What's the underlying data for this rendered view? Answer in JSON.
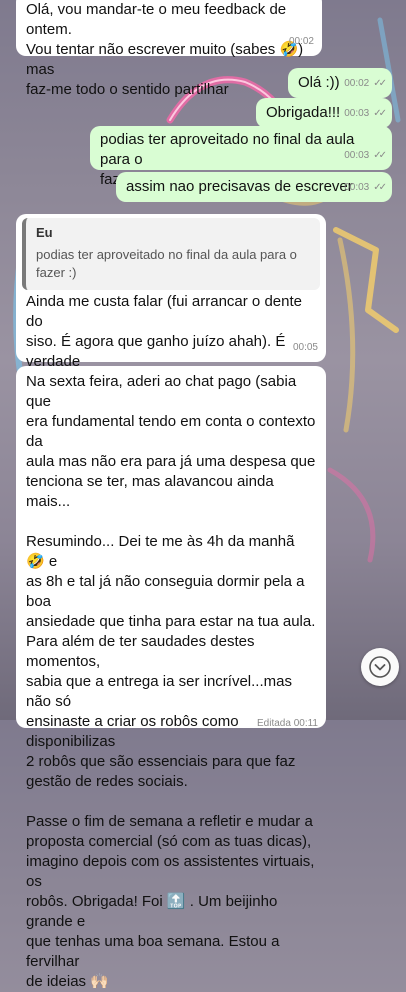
{
  "messages": [
    {
      "id": "m1",
      "direction": "incoming",
      "text": "Olá, vou mandar-te o meu feedback de ontem.\nVou tentar não escrever muito (sabes 🤣) mas\nfaz-me todo o sentido partilhar",
      "time": "00:02"
    },
    {
      "id": "m2",
      "direction": "outgoing",
      "text": "Olá :))",
      "time": "00:02",
      "status": "read"
    },
    {
      "id": "m3",
      "direction": "outgoing",
      "text": "Obrigada!!!",
      "time": "00:03",
      "status": "read"
    },
    {
      "id": "m4",
      "direction": "outgoing",
      "text": "podias ter aproveitado no final da aula para o\nfazer :)",
      "time": "00:03",
      "status": "read"
    },
    {
      "id": "m5",
      "direction": "outgoing",
      "text": "assim nao precisavas de escrever",
      "time": "00:03",
      "status": "read"
    },
    {
      "id": "m6",
      "direction": "incoming",
      "reply": {
        "author": "Eu",
        "text": "podias ter aproveitado no final da aula para o fazer :)"
      },
      "text": "Ainda me custa falar (fui arrancar o dente do\nsiso. É agora que ganho juízo ahah). É verdade\nmas gosto de escrever e até podes usar como\n\"prova social\" , não é que precises mas\nexpresso melhor a escrever, como sabes.",
      "time": "00:05"
    },
    {
      "id": "m7",
      "direction": "incoming",
      "text": "Na sexta feira, aderi ao chat pago (sabia que\nera fundamental tendo em conta o contexto da\naula mas não era para já uma despesa que\ntenciona se ter, mas alavancou ainda mais...\n\nResumindo... Dei te me às 4h da manhã 🤣 e\nas 8h e tal já não conseguia dormir pela a boa\nansiedade que tinha para estar na tua aula.\nPara além de ter saudades destes momentos,\nsabia que a entrega ia ser incrível...mas não só\nensinaste a criar os robôs como disponibilizas\n2 robôs que são essenciais para que faz\ngestão de redes sociais.\n\nPasse o fim de semana a refletir e mudar a\nproposta comercial (só com as tuas dicas),\nimagino depois com os assistentes virtuais, os\nrobôs. Obrigada! Foi 🔝 . Um beijinho grande e\nque tenhas uma boa semana. Estou a fervilhar\nde ideias 🙌🏻",
      "time": "Editada 00:11"
    }
  ],
  "read_ticks": "✓✓",
  "scroll_button": {
    "icon": "chevron-down-circle-icon"
  },
  "colors": {
    "incoming_bubble": "#ffffff",
    "outgoing_bubble": "#d9fdd3",
    "meta_text": "#8a8a8a",
    "neon_pink": "#f06aa8",
    "neon_yellow": "#f6d06a",
    "neon_blue": "#79c8f0"
  }
}
